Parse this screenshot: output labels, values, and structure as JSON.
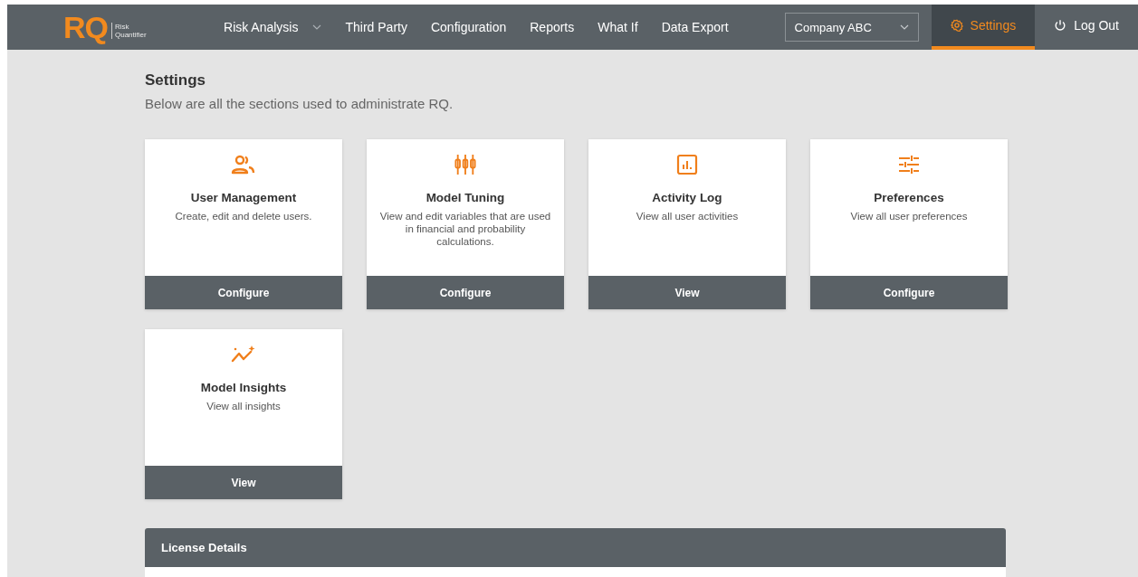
{
  "header": {
    "logo": "RQ",
    "logo_sub_1": "Risk",
    "logo_sub_2": "Quantifier",
    "nav": [
      {
        "label": "Risk Analysis",
        "dropdown": true
      },
      {
        "label": "Third Party",
        "dropdown": false
      },
      {
        "label": "Configuration",
        "dropdown": false
      },
      {
        "label": "Reports",
        "dropdown": false
      },
      {
        "label": "What If",
        "dropdown": false
      },
      {
        "label": "Data Export",
        "dropdown": false
      }
    ],
    "company_select": {
      "value": "Company ABC"
    },
    "actions": [
      {
        "label": "Settings",
        "kind": "settings",
        "selected": true
      },
      {
        "label": "Log Out",
        "kind": "logout",
        "selected": false
      }
    ]
  },
  "page": {
    "title": "Settings",
    "subtitle": "Below are all the sections used to administrate RQ."
  },
  "cards": [
    {
      "kind": "users",
      "title": "User Management",
      "description": "Create, edit and delete users.",
      "button": "Configure"
    },
    {
      "kind": "tuning",
      "title": "Model Tuning",
      "description": "View and edit variables that are used in financial and probability calculations.",
      "button": "Configure"
    },
    {
      "kind": "log",
      "title": "Activity Log",
      "description": "View all user activities",
      "button": "View"
    },
    {
      "kind": "sliders",
      "title": "Preferences",
      "description": "View all user preferences",
      "button": "Configure"
    },
    {
      "kind": "insights",
      "title": "Model Insights",
      "description": "View all insights",
      "button": "View"
    }
  ],
  "license": {
    "title": "License Details"
  }
}
